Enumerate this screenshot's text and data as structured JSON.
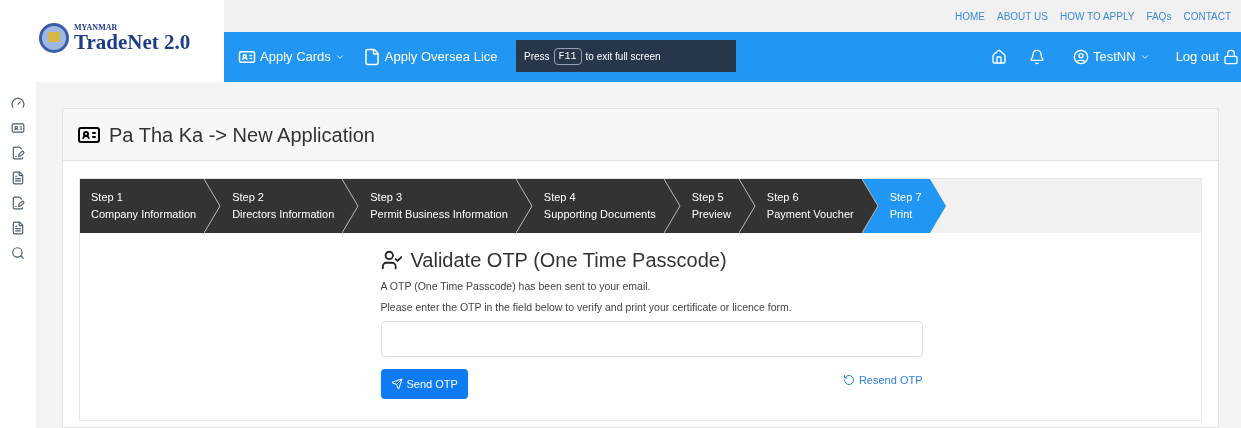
{
  "logo": {
    "small": "MYANMAR",
    "name": "TradeNet 2.0"
  },
  "top_links": [
    "HOME",
    "ABOUT US",
    "HOW TO APPLY",
    "FAQs",
    "CONTACT"
  ],
  "nav": {
    "items": [
      {
        "label": "Apply Cards",
        "kind": "dropdown"
      },
      {
        "label": "Apply Oversea Lice",
        "kind": "plain"
      }
    ],
    "user": "TestNN",
    "logout": "Log out"
  },
  "fullscreen_notice": {
    "before": "Press",
    "key": "F11",
    "after": "to exit full screen"
  },
  "page_title": "Pa Tha Ka -> New Application",
  "steps": [
    {
      "number": "Step 1",
      "label": "Company Information",
      "selected": false
    },
    {
      "number": "Step 2",
      "label": "Directors Information",
      "selected": false
    },
    {
      "number": "Step 3",
      "label": "Permit Business Information",
      "selected": false
    },
    {
      "number": "Step 4",
      "label": "Supporting Documents",
      "selected": false
    },
    {
      "number": "Step 5",
      "label": "Preview",
      "selected": false
    },
    {
      "number": "Step 6",
      "label": "Payment Voucher",
      "selected": false
    },
    {
      "number": "Step 7",
      "label": "Print",
      "selected": true
    }
  ],
  "otp": {
    "heading": "Validate OTP (One Time Passcode)",
    "lines": [
      "A OTP (One Time Passcode) has been sent to your email.",
      "Please enter the OTP in the field below to verify and print your certificate or licence form."
    ],
    "send": "Send OTP",
    "resend": "Resend OTP"
  }
}
